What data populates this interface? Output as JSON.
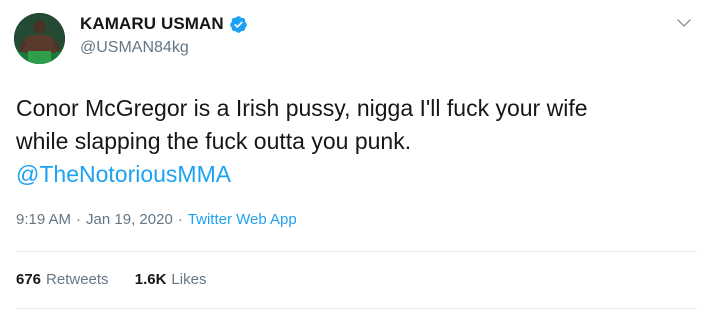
{
  "author": {
    "display_name": "KAMARU USMAN",
    "handle": "@USMAN84kg",
    "verified": true
  },
  "tweet": {
    "text_line_1": "Conor McGregor is a Irish pussy, nigga I'll fuck your wife",
    "text_line_2": "while slapping the fuck outta you punk.",
    "mention": "@TheNotoriousMMA"
  },
  "meta": {
    "time": "9:19 AM",
    "separator": "·",
    "date": "Jan 19, 2020",
    "source": "Twitter Web App"
  },
  "stats": {
    "retweets_count": "676",
    "retweets_label": "Retweets",
    "likes_count": "1.6K",
    "likes_label": "Likes"
  },
  "colors": {
    "link": "#1da1f2",
    "secondary_text": "#657786",
    "primary_text": "#14171a",
    "divider": "#e6ecf0"
  },
  "icons": {
    "verified": "verified-badge-icon",
    "menu": "chevron-down-icon"
  }
}
